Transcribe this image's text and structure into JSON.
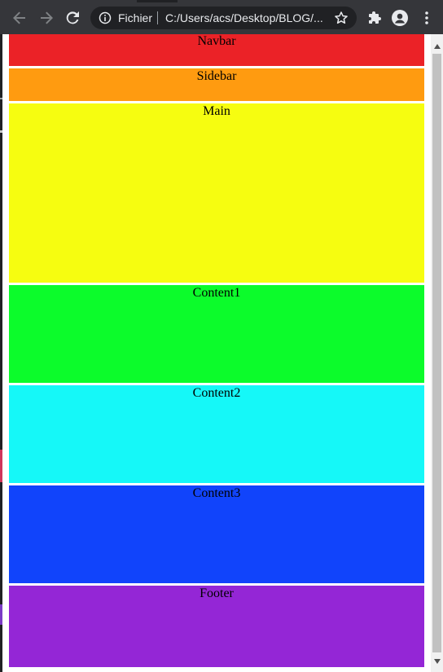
{
  "browser": {
    "scheme_label": "Fichier",
    "url": "C:/Users/acs/Desktop/BLOG/...",
    "icons": {
      "back": "arrow-left-icon",
      "forward": "arrow-right-icon",
      "reload": "reload-icon",
      "info": "info-icon",
      "bookmark": "star-icon",
      "extensions": "puzzle-icon",
      "profile": "person-icon",
      "menu": "kebab-menu-icon"
    }
  },
  "page": {
    "sections": [
      {
        "label": "Navbar",
        "color": "#eb2227"
      },
      {
        "label": "Sidebar",
        "color": "#ff9b10"
      },
      {
        "label": "Main",
        "color": "#f6fd10"
      },
      {
        "label": "Content1",
        "color": "#0cfc2b"
      },
      {
        "label": "Content2",
        "color": "#15f8f8"
      },
      {
        "label": "Content3",
        "color": "#1144fb"
      },
      {
        "label": "Footer",
        "color": "#9426d6"
      }
    ]
  }
}
